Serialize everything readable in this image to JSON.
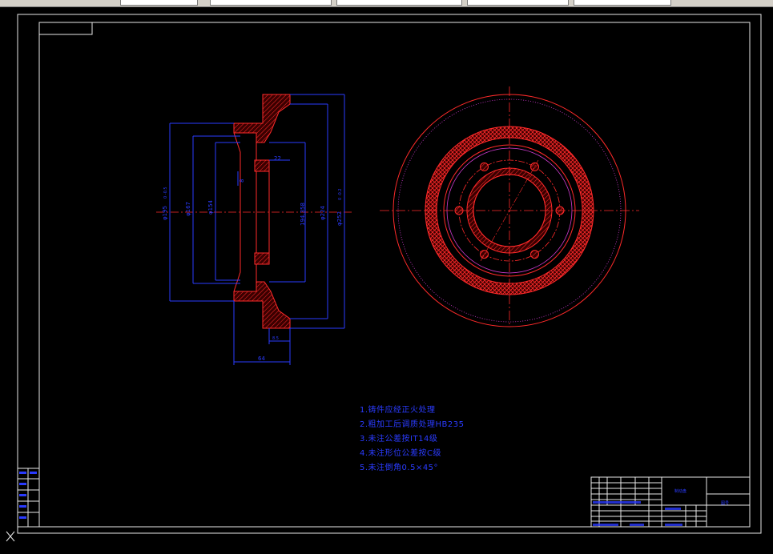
{
  "toolbar": {
    "fields": [
      "",
      "",
      "",
      "",
      "",
      ""
    ]
  },
  "views": {
    "section": {
      "dims": {
        "d_outer": "φ195",
        "d_outer_tol": "0 -0.5",
        "d_167": "φ167",
        "d_154": "φ154",
        "d_8": "8",
        "d_22": "22",
        "d_194": "194.358",
        "d_224": "φ224",
        "d_252": "φ252",
        "d_252_tol": "0 -0.2",
        "d_width": "64",
        "d_small": "8.5"
      }
    }
  },
  "notes": [
    "1.铸件应经正火处理",
    "2.粗加工后调质处理HB235",
    "3.未注公差按IT14级",
    "4.未注形位公差按C级",
    "5.未注倒角0.5×45°"
  ],
  "titleblock": {
    "part_name": "制动盘",
    "drawing_no": "图号"
  },
  "colors": {
    "background": "#000000",
    "geometry": "#ff2a2a",
    "dimension": "#2a3bff",
    "border": "#e8e8e8",
    "magenta": "#d13bd1"
  },
  "ucs_icon": "ucs-x-axis-icon"
}
